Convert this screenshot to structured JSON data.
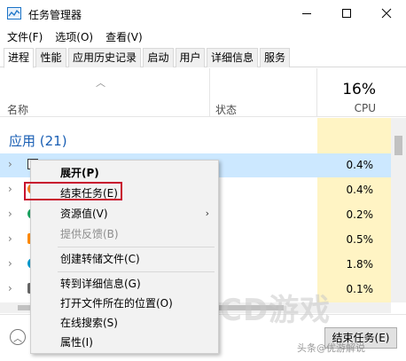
{
  "window": {
    "title": "任务管理器",
    "controls": [
      "minimize-icon",
      "maximize-icon",
      "close-icon"
    ]
  },
  "menu": [
    "文件(F)",
    "选项(O)",
    "查看(V)"
  ],
  "tabs": [
    "进程",
    "性能",
    "应用历史记录",
    "启动",
    "用户",
    "详细信息",
    "服务"
  ],
  "active_tab": "进程",
  "header": {
    "name_col": "名称",
    "status_col": "状态",
    "cpu_percent": "16%",
    "cpu_label": "CPU"
  },
  "group": {
    "title": "应用 (21)"
  },
  "rows": [
    {
      "cpu": "0.4%",
      "icon_color": "#ffffff",
      "selected": true
    },
    {
      "cpu": "0.4%",
      "icon_color": "#f47b20"
    },
    {
      "cpu": "0.2%",
      "icon_color": "#1aa260"
    },
    {
      "cpu": "0.5%",
      "icon_color": "#ff8a00"
    },
    {
      "cpu": "1.8%",
      "icon_color": "#0099cc"
    },
    {
      "cpu": "0.1%",
      "icon_color": "#666666"
    }
  ],
  "context_menu": {
    "items": [
      {
        "label": "展开(P)",
        "bold": true
      },
      {
        "label": "结束任务(E)",
        "highlighted": true
      },
      {
        "label": "资源值(V)",
        "submenu": true
      },
      {
        "label": "提供反馈(B)",
        "disabled": true
      },
      {
        "label": "创建转储文件(C)"
      },
      {
        "label": "转到详细信息(G)"
      },
      {
        "label": "打开文件所在的位置(O)"
      },
      {
        "label": "在线搜索(S)"
      },
      {
        "label": "属性(I)"
      }
    ],
    "highlight_color": "#c8102e"
  },
  "footer": {
    "end_task_label": "结束任务(E)"
  },
  "watermark": {
    "logo": "CD游戏",
    "credit": "头条@优游解说"
  },
  "colors": {
    "accent": "#1a5fb4",
    "cpu_column": "#fff4c4",
    "selected_row": "#cce8ff"
  }
}
